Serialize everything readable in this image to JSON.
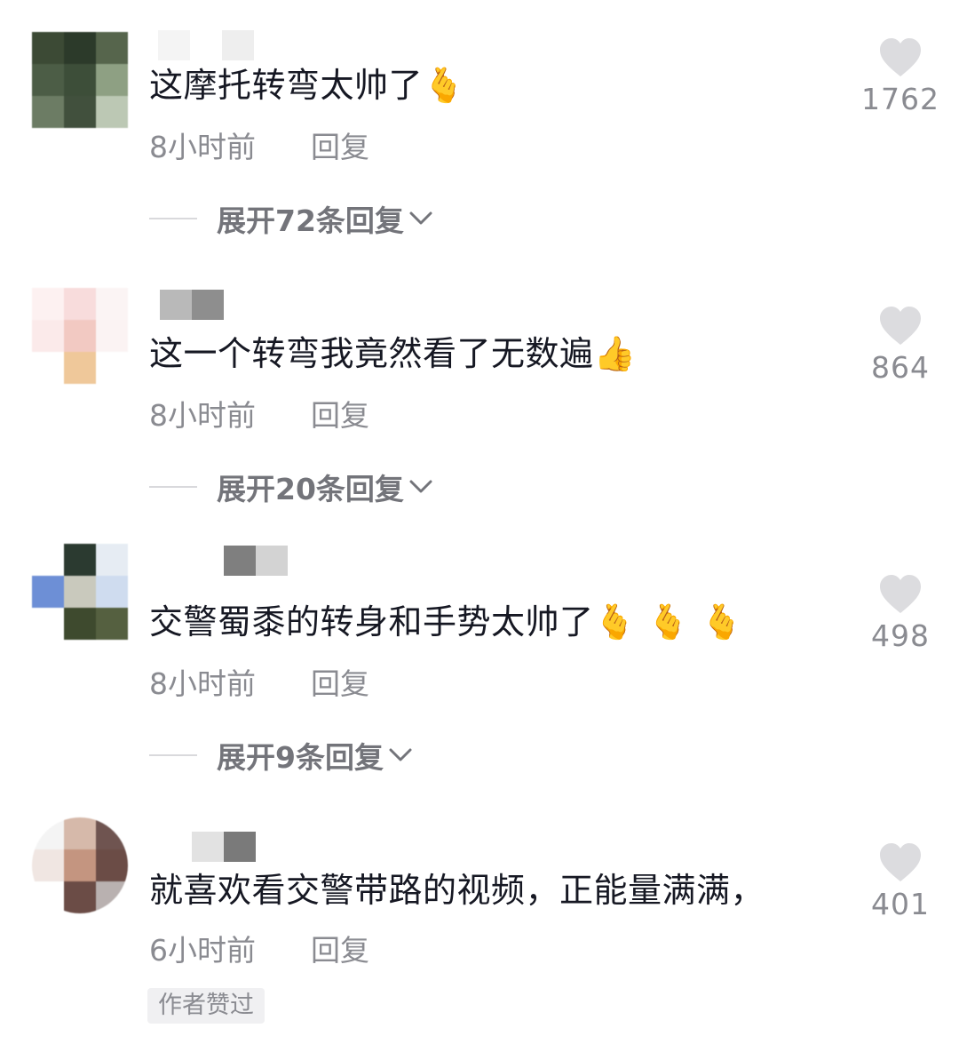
{
  "comments": [
    {
      "text": "这摩托转弯太帅了",
      "emoji": "🫰",
      "time": "8小时前",
      "reply_label": "回复",
      "expand_label": "展开72条回复",
      "likes": "1762"
    },
    {
      "text": "这一个转弯我竟然看了无数遍",
      "emoji": "👍",
      "time": "8小时前",
      "reply_label": "回复",
      "expand_label": "展开20条回复",
      "likes": "864"
    },
    {
      "text": "交警蜀黍的转身和手势太帅了",
      "emoji": "🫰 🫰 🫰",
      "time": "8小时前",
      "reply_label": "回复",
      "expand_label": "展开9条回复",
      "likes": "498"
    },
    {
      "text": "就喜欢看交警带路的视频，正能量满满，",
      "emoji": "",
      "time": "6小时前",
      "reply_label": "回复",
      "badge": "作者赞过",
      "likes": "401"
    }
  ],
  "icons": {
    "like": "heart-icon",
    "expand": "chevron-down-icon"
  },
  "colors": {
    "text": "#161823",
    "meta": "#8a8b91",
    "expand": "#73747a",
    "heart": "#dcdcdf"
  }
}
